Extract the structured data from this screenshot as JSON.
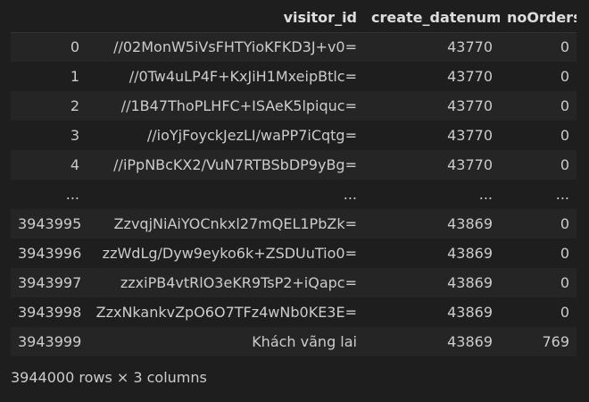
{
  "table": {
    "columns": [
      "",
      "visitor_id",
      "create_datenum",
      "noOrders"
    ],
    "rows": [
      [
        "0",
        "//02MonW5iVsFHTYioKFKD3J+v0=",
        "43770",
        "0"
      ],
      [
        "1",
        "//0Tw4uLP4F+KxJiH1MxeipBtlc=",
        "43770",
        "0"
      ],
      [
        "2",
        "//1B47ThoPLHFC+ISAeK5lpiquc=",
        "43770",
        "0"
      ],
      [
        "3",
        "//ioYjFoyckJezLI/waPP7iCqtg=",
        "43770",
        "0"
      ],
      [
        "4",
        "//iPpNBcKX2/VuN7RTBSbDP9yBg=",
        "43770",
        "0"
      ],
      [
        "...",
        "...",
        "...",
        "..."
      ],
      [
        "3943995",
        "ZzvqjNiAiYOCnkxl27mQEL1PbZk=",
        "43869",
        "0"
      ],
      [
        "3943996",
        "zzWdLg/Dyw9eyko6k+ZSDUuTio0=",
        "43869",
        "0"
      ],
      [
        "3943997",
        "zzxiPB4vtRlO3eKR9TsP2+iQapc=",
        "43869",
        "0"
      ],
      [
        "3943998",
        "ZzxNkankvZpO6O7TFz4wNb0KE3E=",
        "43869",
        "0"
      ],
      [
        "3943999",
        "Khách vãng lai",
        "43869",
        "769"
      ]
    ]
  },
  "footer": {
    "shape_text": "3944000 rows × 3 columns"
  }
}
